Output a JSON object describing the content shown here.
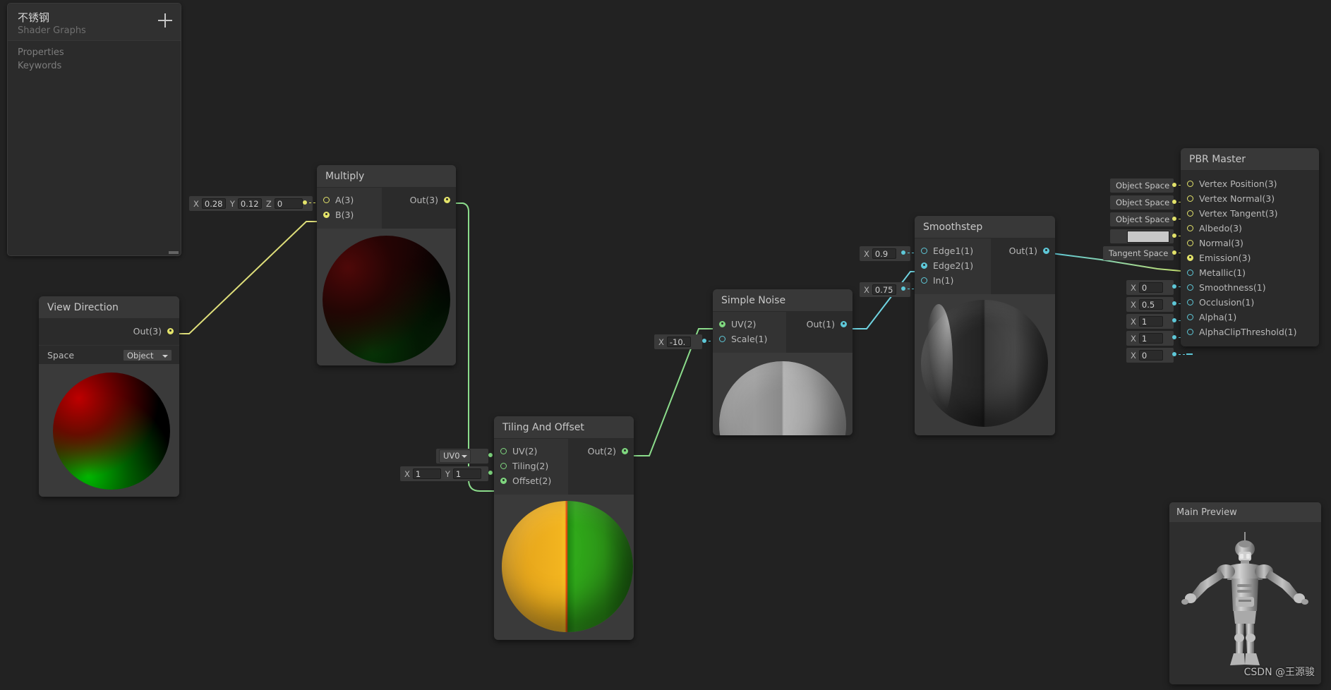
{
  "blackboard": {
    "title": "不锈钢",
    "subtitle": "Shader Graphs",
    "add_label": "+",
    "sections": [
      "Properties",
      "Keywords"
    ]
  },
  "nodes": {
    "view_direction": {
      "title": "View Direction",
      "out_port": "Out(3)",
      "space_label": "Space",
      "space_value": "Object"
    },
    "multiply": {
      "title": "Multiply",
      "in_a": "A(3)",
      "in_b": "B(3)",
      "out": "Out(3)",
      "a_fields": {
        "x_label": "X",
        "x_value": "0.28",
        "y_label": "Y",
        "y_value": "0.12",
        "z_label": "Z",
        "z_value": "0"
      }
    },
    "tiling_and_offset": {
      "title": "Tiling And Offset",
      "in_uv": "UV(2)",
      "in_tiling": "Tiling(2)",
      "in_offset": "Offset(2)",
      "out": "Out(2)",
      "uv_channel": "UV0",
      "tiling_fields": {
        "x_label": "X",
        "x_value": "1",
        "y_label": "Y",
        "y_value": "1"
      }
    },
    "simple_noise": {
      "title": "Simple Noise",
      "in_uv": "UV(2)",
      "in_scale": "Scale(1)",
      "out": "Out(1)",
      "scale_field": {
        "x_label": "X",
        "x_value": "-10."
      }
    },
    "smoothstep": {
      "title": "Smoothstep",
      "in_edge1": "Edge1(1)",
      "in_edge2": "Edge2(1)",
      "in_in": "In(1)",
      "out": "Out(1)",
      "edge1_field": {
        "x_label": "X",
        "x_value": "0.9"
      },
      "in_field": {
        "x_label": "X",
        "x_value": "0.75"
      }
    },
    "pbr_master": {
      "title": "PBR Master",
      "slots": [
        {
          "label": "Vertex Position(3)",
          "widget": "enum",
          "value": "Object Space"
        },
        {
          "label": "Vertex Normal(3)",
          "widget": "enum",
          "value": "Object Space"
        },
        {
          "label": "Vertex Tangent(3)",
          "widget": "enum",
          "value": "Object Space"
        },
        {
          "label": "Albedo(3)",
          "widget": "color",
          "value": "#c8c8c8"
        },
        {
          "label": "Normal(3)",
          "widget": "enum",
          "value": "Tangent Space"
        },
        {
          "label": "Emission(3)",
          "widget": "none",
          "value": ""
        },
        {
          "label": "Metallic(1)",
          "widget": "num",
          "value": "0"
        },
        {
          "label": "Smoothness(1)",
          "widget": "num",
          "value": "0.5"
        },
        {
          "label": "Occlusion(1)",
          "widget": "num",
          "value": "1"
        },
        {
          "label": "Alpha(1)",
          "widget": "num",
          "value": "1"
        },
        {
          "label": "AlphaClipThreshold(1)",
          "widget": "num",
          "value": "0"
        }
      ],
      "num_x_label": "X"
    }
  },
  "main_preview": {
    "title": "Main Preview"
  },
  "watermark": "CSDN @王源骏",
  "colors": {
    "vector3_port": "#e3e36a",
    "vector2_port": "#7fd77f",
    "float_port": "#5ec8d8",
    "canvas_bg": "#222222",
    "node_bg": "#2b2b2b",
    "node_header": "#383838"
  }
}
